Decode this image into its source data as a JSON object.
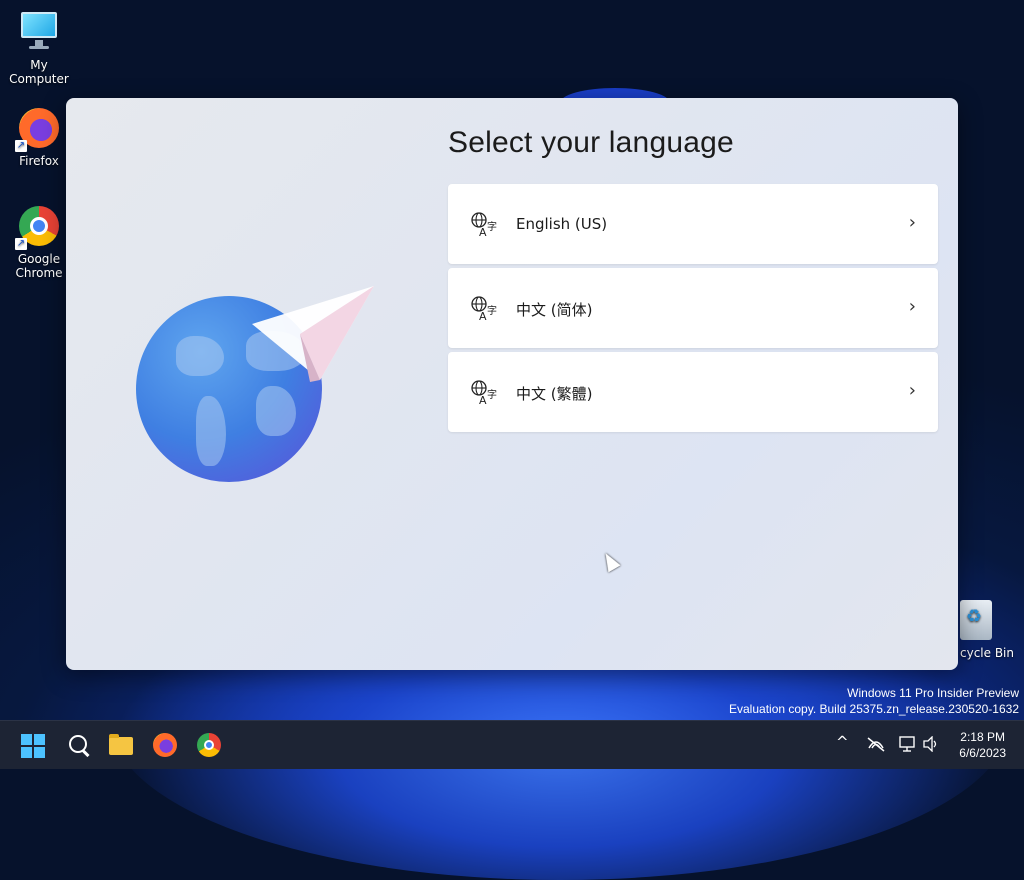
{
  "desktop": {
    "icons": [
      {
        "label": "My Computer"
      },
      {
        "label": "Firefox"
      },
      {
        "label": "Google Chrome"
      },
      {
        "label": "cycle Bin"
      }
    ]
  },
  "setup": {
    "title": "Select your language",
    "languages": [
      {
        "label": "English (US)"
      },
      {
        "label": "中文 (简体)"
      },
      {
        "label": "中文 (繁體)"
      }
    ],
    "chevron": "›",
    "lang_icon": "language-icon"
  },
  "watermark": {
    "line1": "Windows 11 Pro Insider Preview",
    "line2": "Evaluation copy. Build 25375.zn_release.230520-1632"
  },
  "taskbar": {
    "time": "2:18 PM",
    "date": "6/6/2023",
    "tray_up": "^",
    "accent": "#4cc2ff"
  }
}
